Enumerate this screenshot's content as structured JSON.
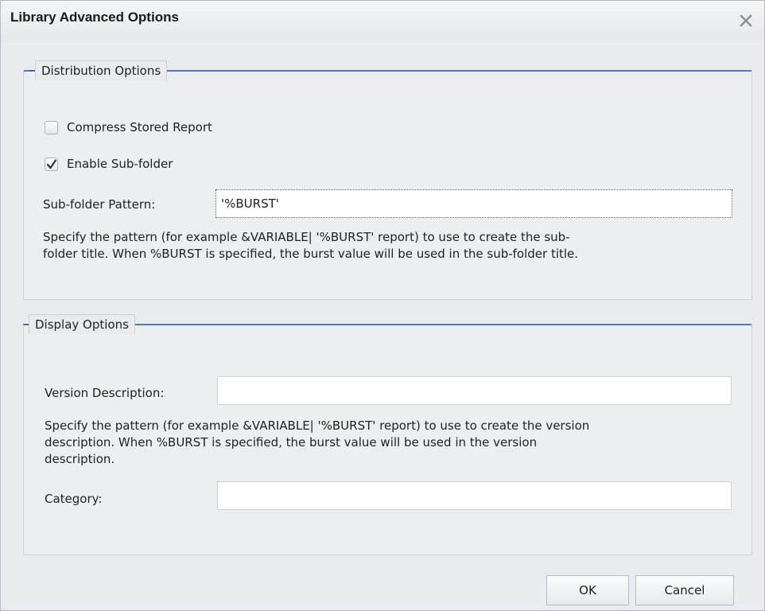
{
  "dialog": {
    "title": "Library Advanced Options"
  },
  "icons": {
    "close": "close-icon",
    "checkmark": "checkmark-icon"
  },
  "distribution": {
    "legend": "Distribution Options",
    "compress_label": "Compress Stored Report",
    "compress_checked": false,
    "subfolder_label": "Enable Sub-folder",
    "subfolder_checked": true,
    "pattern_label": "Sub-folder Pattern:",
    "pattern_value": "'%BURST'",
    "help_line1": "Specify the pattern (for example &VARIABLE| '%BURST' report) to use to create the sub-",
    "help_line2": "folder title. When %BURST is specified, the burst value will be used in the sub-folder title."
  },
  "display": {
    "legend": "Display Options",
    "version_label": "Version Description:",
    "version_value": "",
    "help_line1": "Specify the pattern (for example &VARIABLE| '%BURST' report) to use to create the version",
    "help_line2": "description. When %BURST is specified, the burst value will be used in the version",
    "help_line3": "description.",
    "category_label": "Category:",
    "category_value": ""
  },
  "buttons": {
    "ok": "OK",
    "cancel": "Cancel"
  },
  "colors": {
    "accent_line": "#4f79c0",
    "background": "#e9ebee"
  }
}
